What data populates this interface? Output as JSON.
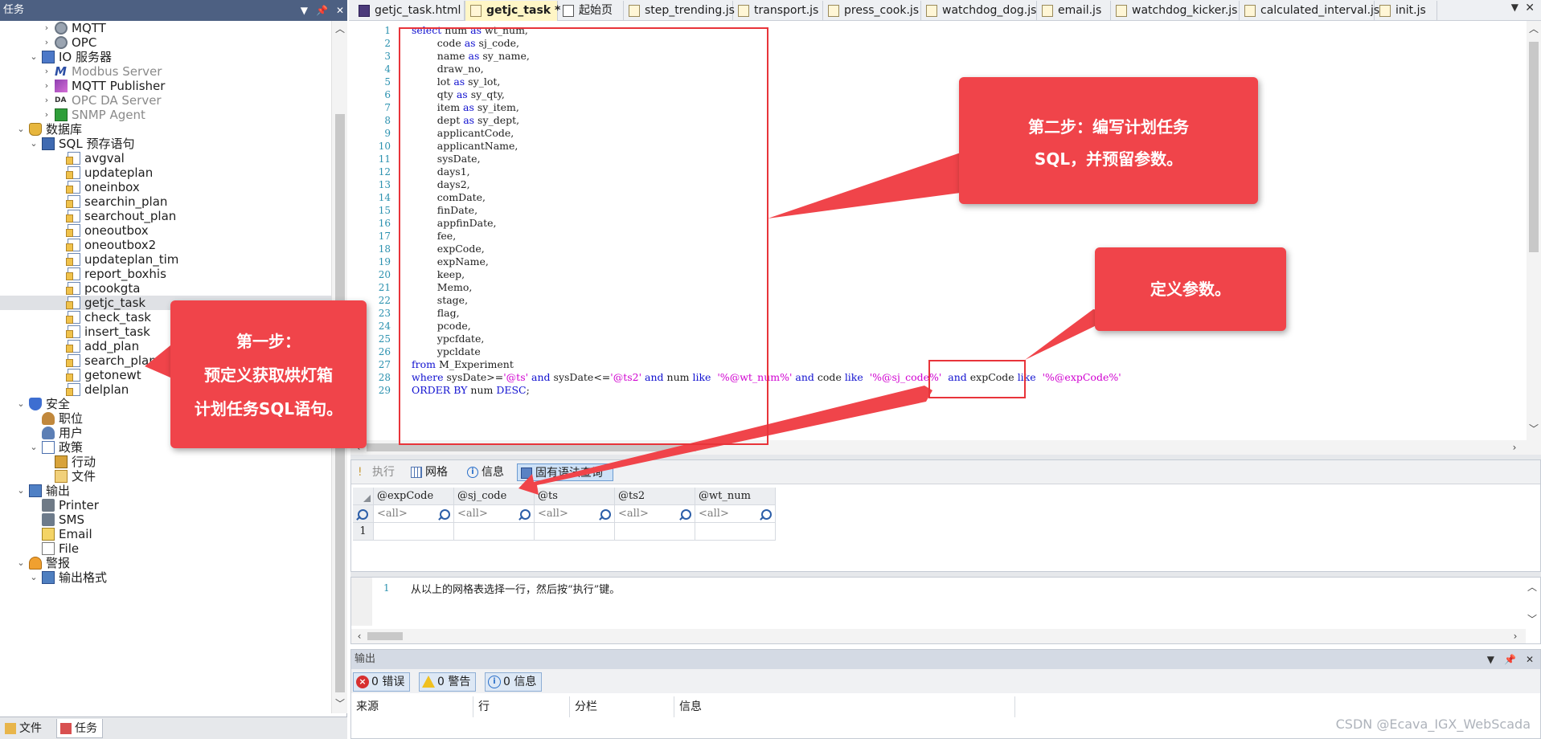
{
  "left_panel": {
    "title": "任务",
    "tree": [
      {
        "label": "MQTT",
        "level": 4,
        "arrow": "›",
        "icon": "gear-icon",
        "gray": false
      },
      {
        "label": "OPC",
        "level": 4,
        "arrow": "›",
        "icon": "gear-icon",
        "gray": false
      },
      {
        "label": "IO 服务器",
        "level": 3,
        "arrow": "⌄",
        "icon": "io-server-icon",
        "gray": false
      },
      {
        "label": "Modbus Server",
        "level": 4,
        "arrow": "›",
        "icon": "modbus-icon",
        "gray": true
      },
      {
        "label": "MQTT Publisher",
        "level": 4,
        "arrow": "›",
        "icon": "mqtt-publisher-icon",
        "gray": false
      },
      {
        "label": "OPC DA Server",
        "level": 4,
        "arrow": "›",
        "icon": "opc-da-icon",
        "gray": true
      },
      {
        "label": "SNMP Agent",
        "level": 4,
        "arrow": "›",
        "icon": "snmp-icon",
        "gray": true
      },
      {
        "label": "数据库",
        "level": 2,
        "arrow": "⌄",
        "icon": "database-icon",
        "gray": false
      },
      {
        "label": "SQL 预存语句",
        "level": 3,
        "arrow": "⌄",
        "icon": "sql-icon",
        "gray": false
      },
      {
        "label": "avgval",
        "level": 5,
        "arrow": "",
        "icon": "sql-doc-icon",
        "gray": false
      },
      {
        "label": "updateplan",
        "level": 5,
        "arrow": "",
        "icon": "sql-doc-icon",
        "gray": false
      },
      {
        "label": "oneinbox",
        "level": 5,
        "arrow": "",
        "icon": "sql-doc-icon",
        "gray": false
      },
      {
        "label": "searchin_plan",
        "level": 5,
        "arrow": "",
        "icon": "sql-doc-icon",
        "gray": false
      },
      {
        "label": "searchout_plan",
        "level": 5,
        "arrow": "",
        "icon": "sql-doc-icon",
        "gray": false
      },
      {
        "label": "oneoutbox",
        "level": 5,
        "arrow": "",
        "icon": "sql-doc-icon",
        "gray": false
      },
      {
        "label": "oneoutbox2",
        "level": 5,
        "arrow": "",
        "icon": "sql-doc-icon",
        "gray": false
      },
      {
        "label": "updateplan_tim",
        "level": 5,
        "arrow": "",
        "icon": "sql-doc-icon",
        "gray": false
      },
      {
        "label": "report_boxhis",
        "level": 5,
        "arrow": "",
        "icon": "sql-doc-icon",
        "gray": false
      },
      {
        "label": "pcookgta",
        "level": 5,
        "arrow": "",
        "icon": "sql-doc-icon",
        "gray": false
      },
      {
        "label": "getjc_task",
        "level": 5,
        "arrow": "",
        "icon": "sql-doc-icon",
        "gray": false,
        "selected": true
      },
      {
        "label": "check_task",
        "level": 5,
        "arrow": "",
        "icon": "sql-doc-icon",
        "gray": false
      },
      {
        "label": "insert_task",
        "level": 5,
        "arrow": "",
        "icon": "sql-doc-icon",
        "gray": false
      },
      {
        "label": "add_plan",
        "level": 5,
        "arrow": "",
        "icon": "sql-doc-icon",
        "gray": false
      },
      {
        "label": "search_plan",
        "level": 5,
        "arrow": "",
        "icon": "sql-doc-icon",
        "gray": false
      },
      {
        "label": "getonewt",
        "level": 5,
        "arrow": "",
        "icon": "sql-doc-icon",
        "gray": false
      },
      {
        "label": "delplan",
        "level": 5,
        "arrow": "",
        "icon": "sql-doc-icon",
        "gray": false
      },
      {
        "label": "安全",
        "level": 2,
        "arrow": "⌄",
        "icon": "shield-icon",
        "gray": false
      },
      {
        "label": "职位",
        "level": 3,
        "arrow": "",
        "icon": "person-icon",
        "gray": false
      },
      {
        "label": "用户",
        "level": 3,
        "arrow": "",
        "icon": "users-icon",
        "gray": false
      },
      {
        "label": "政策",
        "level": 3,
        "arrow": "⌄",
        "icon": "policy-icon",
        "gray": false
      },
      {
        "label": "行动",
        "level": 4,
        "arrow": "",
        "icon": "action-icon",
        "gray": false
      },
      {
        "label": "文件",
        "level": 4,
        "arrow": "",
        "icon": "file-icon",
        "gray": false
      },
      {
        "label": "输出",
        "level": 2,
        "arrow": "⌄",
        "icon": "output-icon",
        "gray": false
      },
      {
        "label": "Printer",
        "level": 3,
        "arrow": "",
        "icon": "printer-icon",
        "gray": false
      },
      {
        "label": "SMS",
        "level": 3,
        "arrow": "",
        "icon": "sms-icon",
        "gray": false
      },
      {
        "label": "Email",
        "level": 3,
        "arrow": "",
        "icon": "email-icon",
        "gray": false
      },
      {
        "label": "File",
        "level": 3,
        "arrow": "",
        "icon": "file-output-icon",
        "gray": false
      },
      {
        "label": "警报",
        "level": 2,
        "arrow": "⌄",
        "icon": "alarm-icon",
        "gray": false
      },
      {
        "label": "输出格式",
        "level": 3,
        "arrow": "⌄",
        "icon": "format-icon",
        "gray": false
      }
    ],
    "bottom_tabs": [
      {
        "label": "文件",
        "icon": "files-tab-icon",
        "active": false
      },
      {
        "label": "任务",
        "icon": "tasks-tab-icon",
        "active": true
      }
    ]
  },
  "doc_tabs": [
    {
      "label": "getjc_task.html *",
      "icon": "html-file-icon",
      "active": false
    },
    {
      "label": "getjc_task *",
      "icon": "sql-file-icon",
      "active": true
    },
    {
      "label": "起始页",
      "icon": "start-page-icon",
      "active": false
    },
    {
      "label": "step_trending.js",
      "icon": "js-file-icon",
      "active": false
    },
    {
      "label": "transport.js",
      "icon": "js-file-icon",
      "active": false
    },
    {
      "label": "press_cook.js",
      "icon": "js-file-icon",
      "active": false
    },
    {
      "label": "watchdog_dog.js",
      "icon": "js-file-icon",
      "active": false
    },
    {
      "label": "email.js",
      "icon": "js-file-icon",
      "active": false
    },
    {
      "label": "watchdog_kicker.js",
      "icon": "js-file-icon",
      "active": false
    },
    {
      "label": "calculated_interval.js",
      "icon": "js-file-icon",
      "active": false
    },
    {
      "label": "init.js",
      "icon": "js-file-icon",
      "active": false
    }
  ],
  "editor": {
    "lines": [
      [
        {
          "t": "select",
          "c": "kw"
        },
        {
          "t": " num "
        },
        {
          "t": "as",
          "c": "kw"
        },
        {
          "t": " wt_num,"
        }
      ],
      [
        {
          "t": "        code "
        },
        {
          "t": "as",
          "c": "kw"
        },
        {
          "t": " sj_code,"
        }
      ],
      [
        {
          "t": "        name "
        },
        {
          "t": "as",
          "c": "kw"
        },
        {
          "t": " sy_name,"
        }
      ],
      [
        {
          "t": "        draw_no,"
        }
      ],
      [
        {
          "t": "        lot "
        },
        {
          "t": "as",
          "c": "kw"
        },
        {
          "t": " sy_lot,"
        }
      ],
      [
        {
          "t": "        qty "
        },
        {
          "t": "as",
          "c": "kw"
        },
        {
          "t": " sy_qty,"
        }
      ],
      [
        {
          "t": "        item "
        },
        {
          "t": "as",
          "c": "kw"
        },
        {
          "t": " sy_item,"
        }
      ],
      [
        {
          "t": "        dept "
        },
        {
          "t": "as",
          "c": "kw"
        },
        {
          "t": " sy_dept,"
        }
      ],
      [
        {
          "t": "        applicantCode,"
        }
      ],
      [
        {
          "t": "        applicantName,"
        }
      ],
      [
        {
          "t": "        sysDate,"
        }
      ],
      [
        {
          "t": "        days1,"
        }
      ],
      [
        {
          "t": "        days2,"
        }
      ],
      [
        {
          "t": "        comDate,"
        }
      ],
      [
        {
          "t": "        finDate,"
        }
      ],
      [
        {
          "t": "        appfinDate,"
        }
      ],
      [
        {
          "t": "        fee,"
        }
      ],
      [
        {
          "t": "        expCode,"
        }
      ],
      [
        {
          "t": "        expName,"
        }
      ],
      [
        {
          "t": "        keep,"
        }
      ],
      [
        {
          "t": "        Memo,"
        }
      ],
      [
        {
          "t": "        stage,"
        }
      ],
      [
        {
          "t": "        flag,"
        }
      ],
      [
        {
          "t": "        pcode,"
        }
      ],
      [
        {
          "t": "        ypcfdate,"
        }
      ],
      [
        {
          "t": "        ypcldate"
        }
      ],
      [
        {
          "t": "from",
          "c": "kw"
        },
        {
          "t": " M_Experiment"
        }
      ],
      [
        {
          "t": "where",
          "c": "kw"
        },
        {
          "t": " sysDate>="
        },
        {
          "t": "'@ts'",
          "c": "str"
        },
        {
          "t": " "
        },
        {
          "t": "and",
          "c": "kw"
        },
        {
          "t": " sysDate<="
        },
        {
          "t": "'@ts2'",
          "c": "str"
        },
        {
          "t": " "
        },
        {
          "t": "and",
          "c": "kw"
        },
        {
          "t": " num "
        },
        {
          "t": "like",
          "c": "kw"
        },
        {
          "t": "  "
        },
        {
          "t": "'%@wt_num%'",
          "c": "str"
        },
        {
          "t": " "
        },
        {
          "t": "and",
          "c": "kw"
        },
        {
          "t": " code "
        },
        {
          "t": "like",
          "c": "kw"
        },
        {
          "t": "  "
        },
        {
          "t": "'%@sj_code%'",
          "c": "str"
        },
        {
          "t": "  "
        },
        {
          "t": "and",
          "c": "kw"
        },
        {
          "t": " expCode "
        },
        {
          "t": "like",
          "c": "kw"
        },
        {
          "t": "  "
        },
        {
          "t": "'%@expCode%'",
          "c": "str"
        }
      ],
      [
        {
          "t": "ORDER BY",
          "c": "kw"
        },
        {
          "t": " num "
        },
        {
          "t": "DESC",
          "c": "kw"
        },
        {
          "t": ";"
        }
      ]
    ]
  },
  "query_toolbar": {
    "execute": "执行",
    "grid": "网格",
    "info": "信息",
    "syntax": "固有语法查询"
  },
  "param_grid": {
    "columns": [
      "@expCode",
      "@sj_code",
      "@ts",
      "@ts2",
      "@wt_num"
    ],
    "filter_value": "<all>",
    "row_number": "1"
  },
  "hint": {
    "line_number": "1",
    "text": "从以上的网格表选择一行，然后按“执行”键。"
  },
  "output": {
    "title": "输出",
    "errors": "0 错误",
    "warnings": "0 警告",
    "messages": "0 信息",
    "columns": [
      "来源",
      "行",
      "分栏",
      "信息"
    ],
    "watermark": "CSDN @Ecava_IGX_WebScada"
  },
  "callouts": {
    "step1": [
      "第一步：",
      "预定义获取烘灯箱",
      "计划任务SQL语句。"
    ],
    "step2": [
      "第二步：编写计划任务",
      "SQL，并预留参数。"
    ],
    "define": [
      "定义参数。"
    ]
  },
  "colors": {
    "callout": "#f0444a",
    "keyword": "#1010d0",
    "string": "#d000d0",
    "line_number": "#2b91af",
    "panel_header": "#4d6082"
  }
}
